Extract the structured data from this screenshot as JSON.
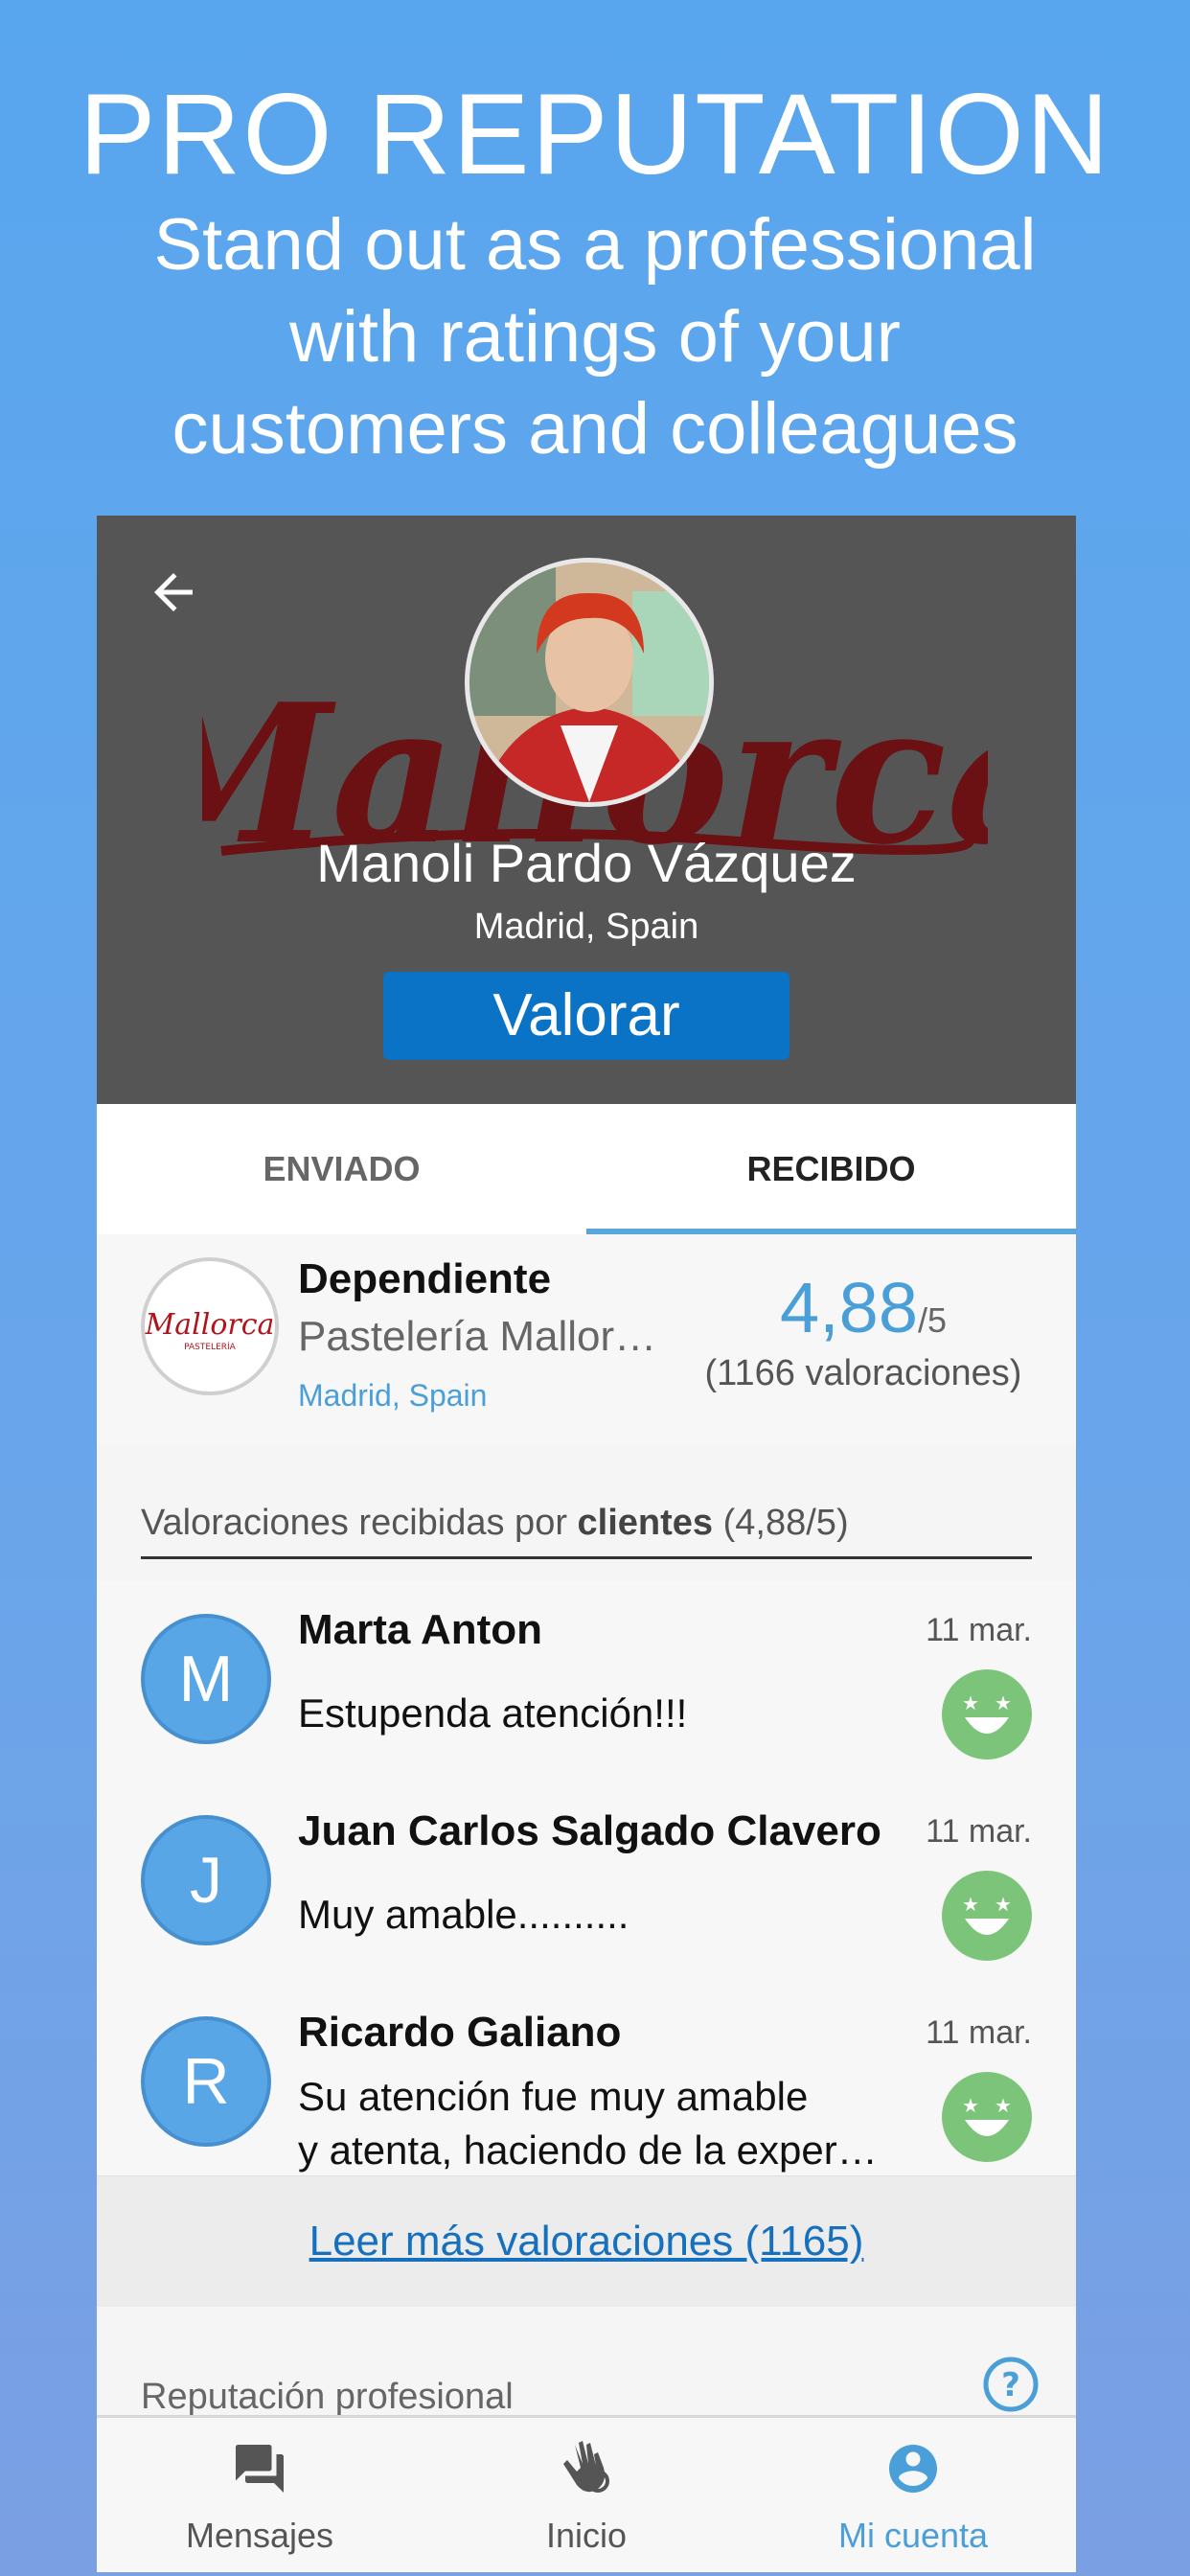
{
  "promo": {
    "title": "PRO REPUTATION",
    "subtitle_lines": [
      "Stand out as a professional",
      "with ratings of your",
      "customers and colleagues"
    ]
  },
  "profile": {
    "name": "Manoli Pardo Vázquez",
    "location": "Madrid, Spain",
    "rate_button": "Valorar",
    "background_logo_text": "Mallorca"
  },
  "tabs": [
    {
      "label": "ENVIADO",
      "active": false
    },
    {
      "label": "RECIBIDO",
      "active": true
    }
  ],
  "business": {
    "role": "Dependiente",
    "company": "Pastelería Mallor…",
    "location": "Madrid, Spain",
    "score": "4,88",
    "score_max": "/5",
    "count": "(1166 valoraciones)",
    "logo_text": "Mallorca",
    "logo_subtext": "PASTELERÍA"
  },
  "section": {
    "prefix": "Valoraciones recibidas por ",
    "bold": "clientes",
    "suffix": " (4,88/5)"
  },
  "reviews": [
    {
      "initial": "M",
      "name": "Marta Anton",
      "date": "11 mar.",
      "text": [
        "Estupenda atención!!!"
      ],
      "rating_icon": "happy-face-icon"
    },
    {
      "initial": "J",
      "name": "Juan Carlos Salgado Clavero",
      "date": "11 mar.",
      "text": [
        "Muy amable.........."
      ],
      "rating_icon": "happy-face-icon"
    },
    {
      "initial": "R",
      "name": "Ricardo Galiano",
      "date": "11 mar.",
      "text": [
        "Su atención fue muy amable",
        "y atenta, haciendo de la exper…"
      ],
      "rating_icon": "happy-face-icon"
    }
  ],
  "read_more": "Leer más valoraciones (1165)",
  "professional_section": "Reputación profesional",
  "nav": [
    {
      "label": "Mensajes",
      "icon": "chat-icon",
      "active": false
    },
    {
      "label": "Inicio",
      "icon": "hand-icon",
      "active": false
    },
    {
      "label": "Mi cuenta",
      "icon": "account-icon",
      "active": true
    }
  ],
  "colors": {
    "accent": "#4b9fd8",
    "button": "#0b73c6",
    "smile": "#7cc47a",
    "avatar": "#58a6e6"
  }
}
